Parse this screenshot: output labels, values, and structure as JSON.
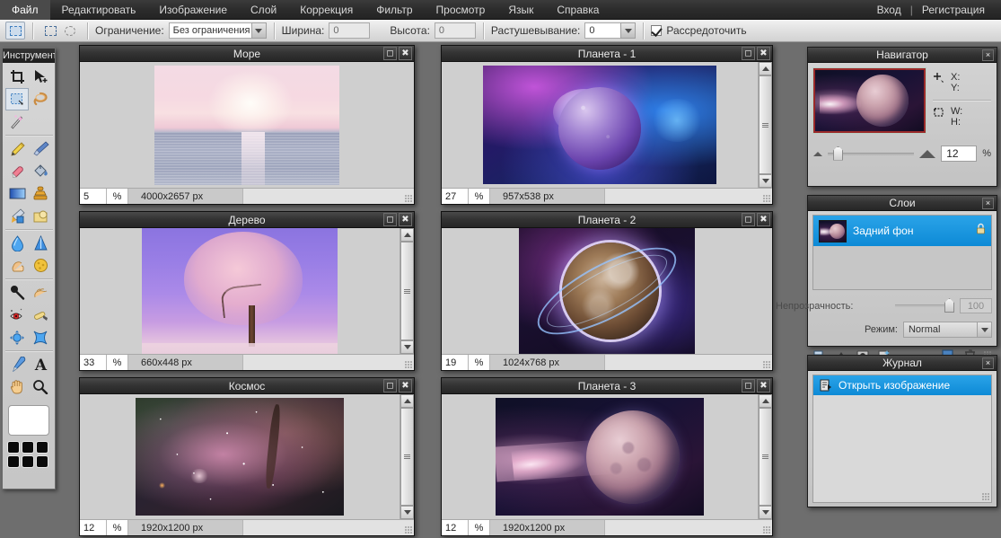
{
  "menubar": {
    "items": [
      {
        "label": "Файл"
      },
      {
        "label": "Редактировать"
      },
      {
        "label": "Изображение"
      },
      {
        "label": "Слой"
      },
      {
        "label": "Коррекция"
      },
      {
        "label": "Фильтр"
      },
      {
        "label": "Просмотр"
      },
      {
        "label": "Язык"
      },
      {
        "label": "Справка"
      }
    ],
    "login": "Вход",
    "separator": "|",
    "register": "Регистрация"
  },
  "options": {
    "constraint_label": "Ограничение:",
    "constraint_value": "Без ограничения",
    "width_label": "Ширина:",
    "width_value": "0",
    "height_label": "Высота:",
    "height_value": "0",
    "feather_label": "Растушевывание:",
    "feather_value": "0",
    "diffuse_label": "Рассредоточить"
  },
  "toolbox": {
    "title": "Инструменты",
    "tools": [
      {
        "name": "crop-tool"
      },
      {
        "name": "move-tool"
      },
      {
        "name": "marquee-select-tool"
      },
      {
        "name": "lasso-tool"
      },
      {
        "name": "magic-wand-tool"
      },
      {
        "name": "pencil-tool"
      },
      {
        "name": "brush-tool"
      },
      {
        "name": "eraser-tool"
      },
      {
        "name": "paint-bucket-tool"
      },
      {
        "name": "gradient-tool"
      },
      {
        "name": "clone-stamp-tool"
      },
      {
        "name": "replace-color-tool"
      },
      {
        "name": "drawing-tool"
      },
      {
        "name": "blur-tool"
      },
      {
        "name": "sharpen-tool"
      },
      {
        "name": "smudge-tool"
      },
      {
        "name": "sponge-tool"
      },
      {
        "name": "dodge-tool"
      },
      {
        "name": "burn-tool"
      },
      {
        "name": "red-eye-tool"
      },
      {
        "name": "spot-heal-tool"
      },
      {
        "name": "bloat-tool"
      },
      {
        "name": "pinch-tool"
      },
      {
        "name": "eyedropper-tool"
      },
      {
        "name": "type-tool"
      },
      {
        "name": "hand-tool"
      },
      {
        "name": "zoom-tool"
      }
    ],
    "foreground_color": "#ffffff",
    "palette_color": "#0a0a0a",
    "palette_count": 6
  },
  "windows": [
    {
      "title": "Море",
      "zoom": "5",
      "percent": "%",
      "dimensions": "4000x2657 px",
      "has_scrollbar": false,
      "maximize": "maximize-icon",
      "close": "close-icon"
    },
    {
      "title": "Планета - 1",
      "zoom": "27",
      "percent": "%",
      "dimensions": "957x538 px",
      "has_scrollbar": true,
      "maximize": "maximize-icon",
      "close": "close-icon"
    },
    {
      "title": "Дерево",
      "zoom": "33",
      "percent": "%",
      "dimensions": "660x448 px",
      "has_scrollbar": true,
      "maximize": "maximize-icon",
      "close": "close-icon"
    },
    {
      "title": "Планета - 2",
      "zoom": "19",
      "percent": "%",
      "dimensions": "1024x768 px",
      "has_scrollbar": false,
      "maximize": "maximize-icon",
      "close": "close-icon"
    },
    {
      "title": "Космос",
      "zoom": "12",
      "percent": "%",
      "dimensions": "1920x1200 px",
      "has_scrollbar": true,
      "maximize": "maximize-icon",
      "close": "close-icon"
    },
    {
      "title": "Планета - 3",
      "zoom": "12",
      "percent": "%",
      "dimensions": "1920x1200 px",
      "has_scrollbar": true,
      "maximize": "maximize-icon",
      "close": "close-icon"
    }
  ],
  "navigator": {
    "title": "Навигатор",
    "close": "×",
    "x_label": "X:",
    "y_label": "Y:",
    "w_label": "W:",
    "h_label": "H:",
    "zoom_value": "12",
    "percent": "%"
  },
  "layers": {
    "title": "Слои",
    "close": "×",
    "items": [
      {
        "name": "Задний фон",
        "locked": true
      }
    ],
    "opacity_label": "Непрозрачность:",
    "opacity_value": "100",
    "mode_label": "Режим:",
    "mode_value": "Normal"
  },
  "history": {
    "title": "Журнал",
    "close": "×",
    "items": [
      {
        "label": "Открыть изображение"
      }
    ]
  }
}
